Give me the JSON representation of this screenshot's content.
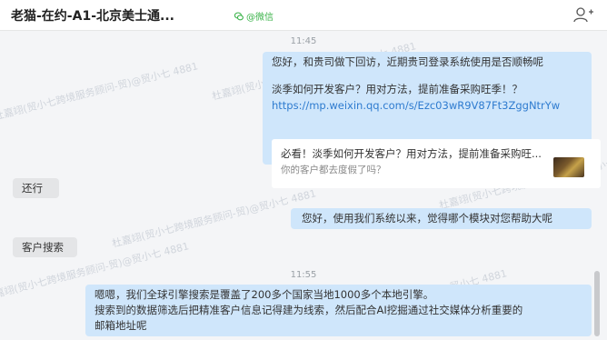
{
  "header": {
    "title": "老猫-在约-A1-北京美士通...",
    "source_label": "@微信",
    "add_icon": "add-person-icon"
  },
  "watermark": "杜嘉翊(贸小七跨境服务顾问-贸)@贸小七 4881",
  "messages": [
    {
      "type": "time",
      "text": "11:45"
    },
    {
      "type": "right",
      "line1": "您好，和贵司做下回访，近期贵司登录系统使用是否顺畅呢",
      "line2": "淡季如何开发客户？用对方法，提前准备采购旺季！？",
      "link": "https://mp.weixin.qq.com/s/Ezc03wR9V87Ft3ZggNtrYw",
      "card": {
        "title": "必看！淡季如何开发客户？用对方法，提前准备采购旺...",
        "desc": "你的客户都去度假了吗？"
      }
    },
    {
      "type": "left",
      "text": "还行"
    },
    {
      "type": "right",
      "text": "您好，使用我们系统以来，觉得哪个模块对您帮助大呢"
    },
    {
      "type": "left",
      "text": "客户搜索"
    },
    {
      "type": "time",
      "text": "11:55"
    },
    {
      "type": "right",
      "line1": "嗯嗯，我们全球引擎搜索是覆盖了200多个国家当地1000多个本地引擎。",
      "line2": "搜索到的数据筛选后把精准客户信息记得建为线索，然后配合AI挖掘通过社交媒体分析重要的",
      "line3": "邮箱地址呢"
    }
  ]
}
